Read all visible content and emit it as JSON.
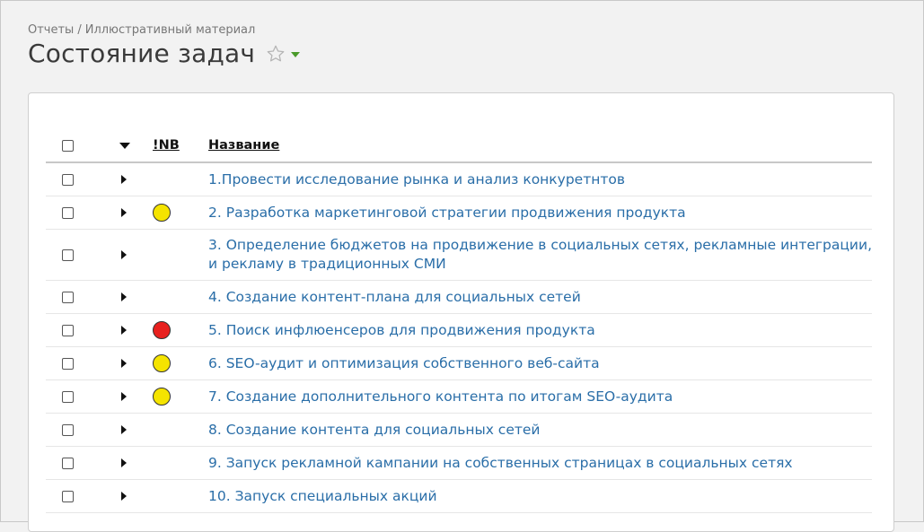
{
  "breadcrumb": {
    "part1": "Отчеты",
    "separator": "/",
    "part2": "Иллюстративный материал"
  },
  "page": {
    "title": "Состояние задач"
  },
  "colors": {
    "link": "#2a6ea8",
    "yellow": "#f5e400",
    "red": "#e8201e",
    "accent_green": "#4a9a2a"
  },
  "table": {
    "headers": {
      "nb": "!NB",
      "name": "Название"
    },
    "rows": [
      {
        "name": "1.Провести исследование рынка и анализ конкуретнтов",
        "status": ""
      },
      {
        "name": "2. Разработка маркетинговой стратегии продвижения продукта",
        "status": "yellow"
      },
      {
        "name": "3. Определение бюджетов на продвижение в социальных сетях, рекламные интеграции, и рекламу в традиционных СМИ",
        "status": ""
      },
      {
        "name": "4. Создание контент-плана для социальных сетей",
        "status": ""
      },
      {
        "name": "5. Поиск инфлюенсеров для продвижения продукта",
        "status": "red"
      },
      {
        "name": "6. SEO-аудит и оптимизация собственного веб-сайта",
        "status": "yellow"
      },
      {
        "name": "7. Создание дополнительного контента по итогам SEO-аудита",
        "status": "yellow"
      },
      {
        "name": "8. Создание контента для социальных сетей",
        "status": ""
      },
      {
        "name": "9. Запуск рекламной кампании на собственных страницах в социальных сетях",
        "status": ""
      },
      {
        "name": "10. Запуск специальных акций",
        "status": ""
      }
    ]
  }
}
